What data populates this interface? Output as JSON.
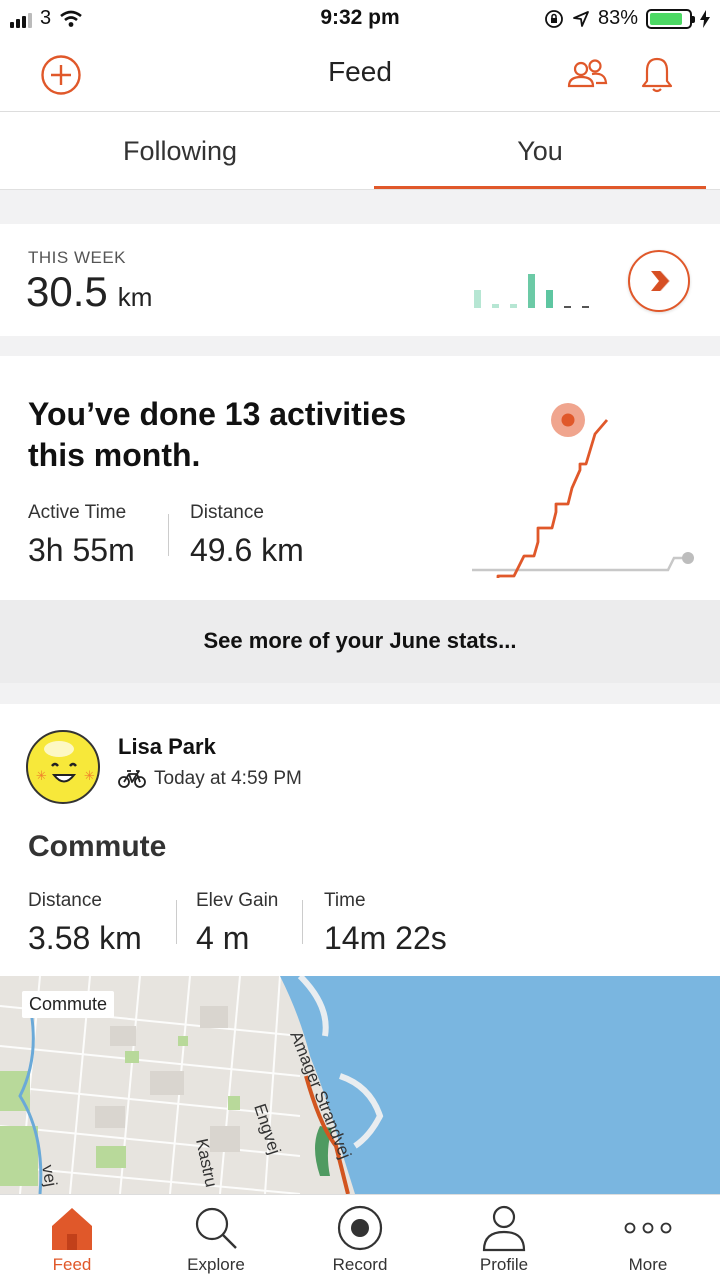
{
  "status_bar": {
    "carrier": "3",
    "time": "9:32 pm",
    "battery": "83%",
    "battery_level": 0.83
  },
  "header": {
    "title": "Feed"
  },
  "tabs": [
    {
      "label": "Following",
      "active": false
    },
    {
      "label": "You",
      "active": true
    }
  ],
  "week": {
    "label": "THIS WEEK",
    "value": "30.5",
    "unit": "km",
    "bars": [
      0.45,
      0.1,
      0.1,
      0.85,
      0.45,
      0.1,
      0.1
    ]
  },
  "month": {
    "headline": "You’ve done 13 activities this month.",
    "active_time_label": "Active Time",
    "active_time": "3h 55m",
    "distance_label": "Distance",
    "distance": "49.6 km"
  },
  "see_more": "See more of your June stats...",
  "activity": {
    "athlete": "Lisa Park",
    "when": "Today at 4:59 PM",
    "title": "Commute",
    "stats": [
      {
        "label": "Distance",
        "value": "3.58 km"
      },
      {
        "label": "Elev Gain",
        "value": "4 m"
      },
      {
        "label": "Time",
        "value": "14m 22s"
      }
    ],
    "map_tag": "Commute",
    "map_labels": {
      "street1": "Amager Strandvej",
      "street2": "Engvej",
      "street3": "Kastru",
      "street4": "vej"
    }
  },
  "nav": [
    {
      "label": "Feed",
      "active": true
    },
    {
      "label": "Explore",
      "active": false
    },
    {
      "label": "Record",
      "active": false
    },
    {
      "label": "Profile",
      "active": false
    },
    {
      "label": "More",
      "active": false
    }
  ],
  "colors": {
    "accent": "#e0582a",
    "week_bar": "#5ec6a1",
    "water": "#7ab6e0"
  }
}
